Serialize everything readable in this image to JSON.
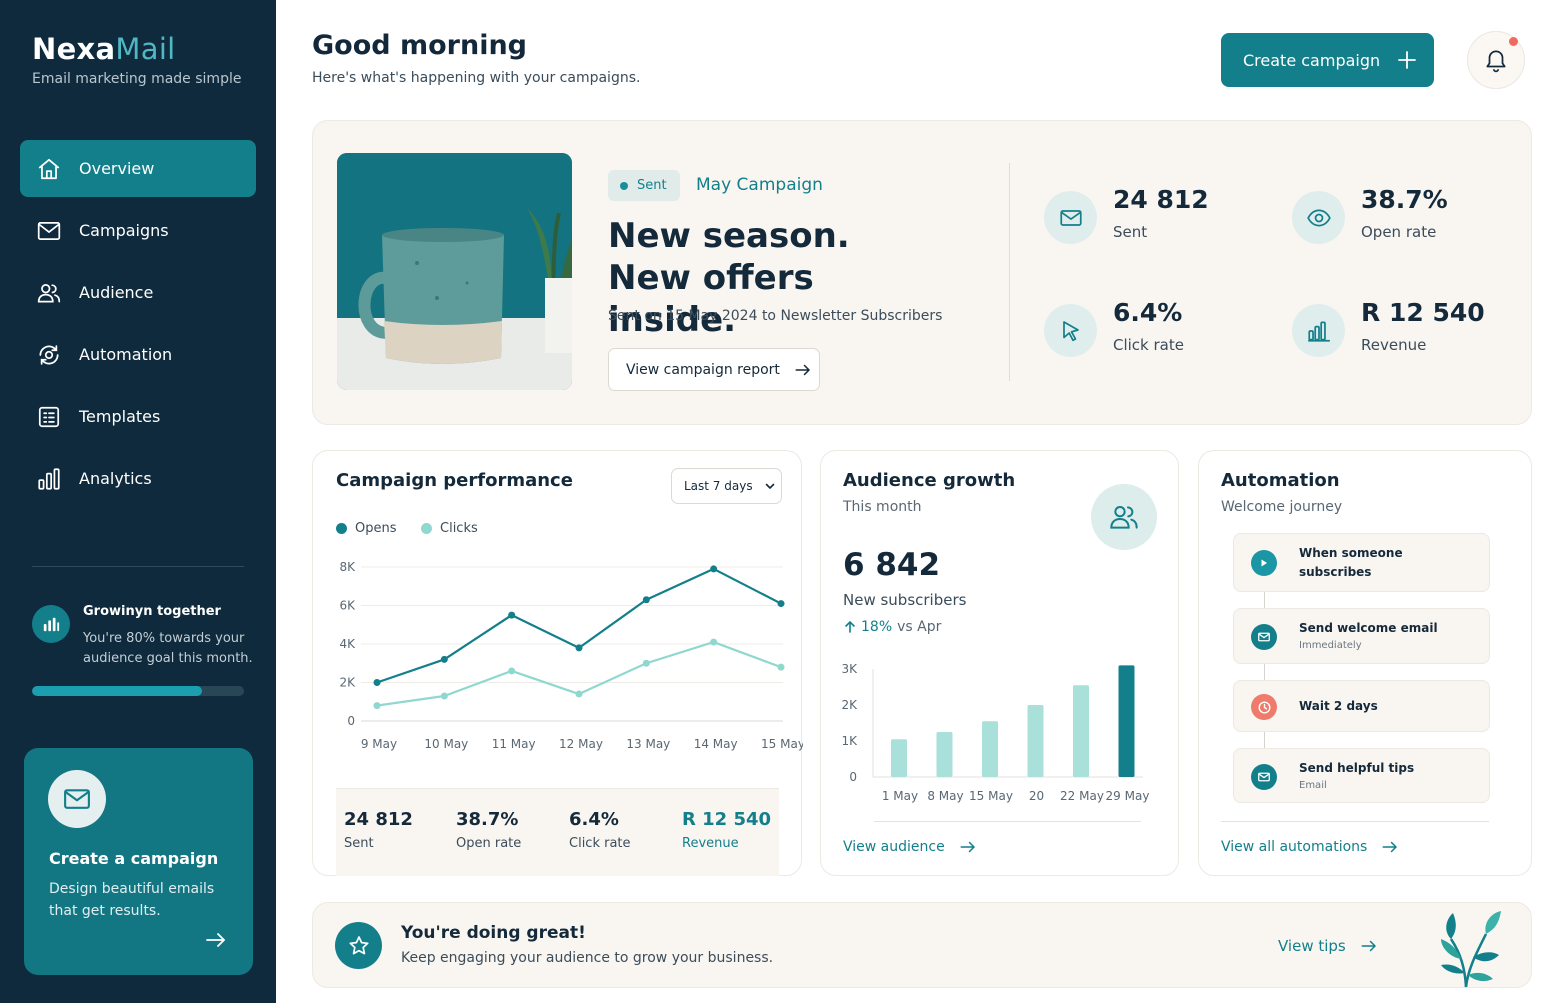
{
  "brand": {
    "name_part1": "Nexa",
    "name_part2": "Mail",
    "tagline": "Email marketing made simple",
    "accent": "#137f8b"
  },
  "sidebar": {
    "items": [
      {
        "label": "Overview",
        "icon": "home-icon",
        "active": true
      },
      {
        "label": "Campaigns",
        "icon": "mail-icon"
      },
      {
        "label": "Audience",
        "icon": "users-icon"
      },
      {
        "label": "Automation",
        "icon": "automation-icon"
      },
      {
        "label": "Templates",
        "icon": "templates-icon"
      },
      {
        "label": "Analytics",
        "icon": "analytics-icon"
      }
    ],
    "goal": {
      "title": "Growinyn together",
      "text": "You're 80% towards your audience goal this month.",
      "progress": 0.8
    },
    "create_card": {
      "title": "Create a campaign",
      "text": "Design beautiful emails that get results."
    }
  },
  "header": {
    "greeting": "Good morning",
    "subtitle": "Here's what's happening with your campaigns.",
    "create_button": "Create campaign"
  },
  "hero": {
    "status": "Sent",
    "campaign_name": "May Campaign",
    "title": "New season. New offers inside.",
    "subtitle": "Sent on 15 May 2024 to Newsletter Subscribers",
    "report_button": "View campaign report",
    "stats": [
      {
        "value": "24 812",
        "label": "Sent",
        "icon": "mail-icon"
      },
      {
        "value": "38.7%",
        "label": "Open rate",
        "icon": "eye-icon"
      },
      {
        "value": "6.4%",
        "label": "Click rate",
        "icon": "cursor-icon"
      },
      {
        "value": "R 12 540",
        "label": "Revenue",
        "icon": "bar-chart-icon"
      }
    ]
  },
  "performance": {
    "title": "Campaign performance",
    "range": "Last 7 days",
    "legend": {
      "opens": "Opens",
      "clicks": "Clicks"
    },
    "summary": [
      {
        "value": "24 812",
        "label": "Sent"
      },
      {
        "value": "38.7%",
        "label": "Open rate"
      },
      {
        "value": "6.4%",
        "label": "Click rate"
      },
      {
        "value": "R 12 540",
        "label": "Revenue"
      }
    ]
  },
  "audience": {
    "title": "Audience growth",
    "subtitle": "This month",
    "value": "6 842",
    "label": "New subscribers",
    "delta": "18%",
    "delta_vs": "vs Apr",
    "link": "View audience"
  },
  "automation": {
    "title": "Automation",
    "subtitle": "Welcome journey",
    "steps": [
      {
        "title": "When someone subscribes",
        "sub": "",
        "icon": "play-icon"
      },
      {
        "title": "Send welcome email",
        "sub": "Immediately",
        "icon": "mail-icon"
      },
      {
        "title": "Wait 2 days",
        "sub": "",
        "icon": "clock-icon"
      },
      {
        "title": "Send helpful tips",
        "sub": "Email",
        "icon": "mail-icon"
      }
    ],
    "link": "View all automations"
  },
  "tip": {
    "title": "You're doing great!",
    "text": "Keep engaging your audience to grow your business.",
    "link": "View tips"
  },
  "chart_data": [
    {
      "type": "line",
      "x": [
        "9 May",
        "10 May",
        "11 May",
        "12 May",
        "13 May",
        "14 May",
        "15 May"
      ],
      "series": [
        {
          "name": "Opens",
          "values": [
            2000,
            3200,
            5500,
            3800,
            6300,
            7900,
            6100
          ],
          "color": "#137f8b"
        },
        {
          "name": "Clicks",
          "values": [
            800,
            1300,
            2600,
            1400,
            3000,
            4100,
            2800
          ],
          "color": "#8fd8cf"
        }
      ],
      "yticks": [
        "0",
        "2K",
        "4K",
        "6K",
        "8K"
      ],
      "ylim": [
        0,
        8000
      ]
    },
    {
      "type": "bar",
      "categories": [
        "1 May",
        "8 May",
        "15 May",
        "20",
        "22 May",
        "29 May"
      ],
      "values": [
        1050,
        1250,
        1550,
        2000,
        2550,
        3100
      ],
      "yticks": [
        "0",
        "1K",
        "2K",
        "3K"
      ],
      "ylim": [
        0,
        3000
      ],
      "bar_color": "#a9e1da",
      "highlight_color": "#137f8b"
    }
  ]
}
